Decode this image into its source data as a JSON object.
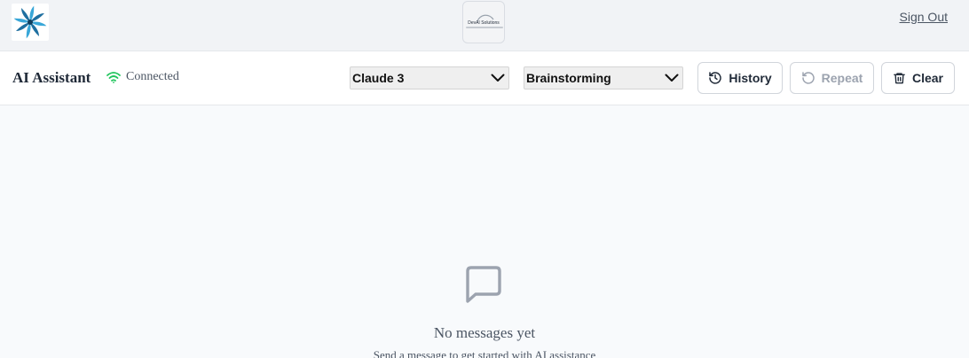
{
  "topbar": {
    "center_logo_text": "DevAI Solutions",
    "signout_label": "Sign Out"
  },
  "header": {
    "title": "AI Assistant",
    "status_text": "Connected",
    "status_color": "#22c55e",
    "model_select": {
      "selected": "Claude 3"
    },
    "mode_select": {
      "selected": "Brainstorming"
    },
    "buttons": {
      "history": "History",
      "repeat": "Repeat",
      "clear": "Clear"
    }
  },
  "empty_state": {
    "icon": "message-square-icon",
    "title": "No messages yet",
    "subtitle": "Send a message to get started with AI assistance"
  },
  "colors": {
    "background": "#f8fafc",
    "topbar": "#f1f3f6",
    "disabled_text": "#9ca3af"
  }
}
